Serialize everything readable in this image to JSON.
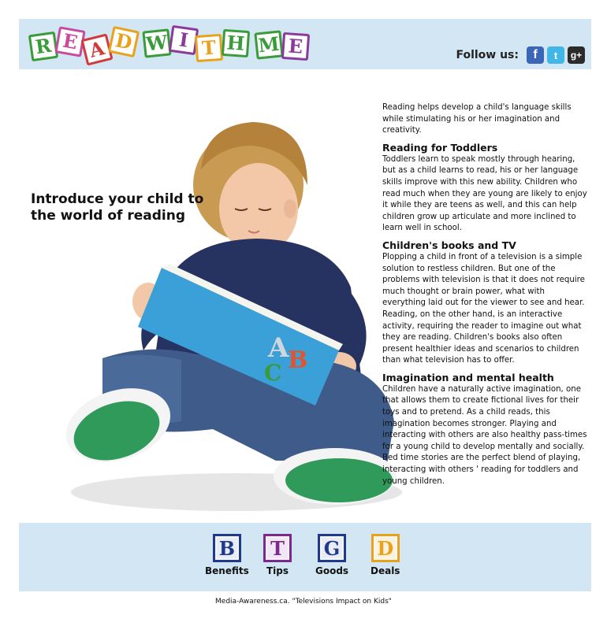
{
  "header": {
    "logo_letters": [
      {
        "char": "R",
        "color": "#3a9b3a"
      },
      {
        "char": "E",
        "color": "#c84aa0"
      },
      {
        "char": "A",
        "color": "#d23a3a"
      },
      {
        "char": "D",
        "color": "#e8a21c"
      },
      {
        "char": "W",
        "color": "#3a9b3a"
      },
      {
        "char": "I",
        "color": "#8b3a9b"
      },
      {
        "char": "T",
        "color": "#e8a21c"
      },
      {
        "char": "H",
        "color": "#3a9b3a"
      },
      {
        "char": "M",
        "color": "#3a9b3a"
      },
      {
        "char": "E",
        "color": "#8b3a9b"
      }
    ],
    "follow_label": "Follow us:",
    "social": {
      "facebook": "f",
      "twitter": "t",
      "googleplus": "g+"
    }
  },
  "hero": {
    "title": "Introduce your child to the world of reading"
  },
  "content": {
    "intro": "Reading helps develop a child's language skills while stimulating his or her imagination and creativity.",
    "sections": [
      {
        "heading": "Reading for Toddlers",
        "body": "Toddlers learn to speak mostly through hearing, but as a child learns to read, his or her language skills improve with this new ability. Children who read much when they are young are likely to enjoy it while they are teens as well, and this can help children grow up articulate and more inclined to learn well in school."
      },
      {
        "heading": "Children's books and TV",
        "body": "Plopping a child in front of a television is a simple solution to restless children. But one of the problems with television is that it does not require much thought or brain power, what with everything laid out for the viewer to see and hear. Reading, on the other hand, is an interactive activity, requiring the reader to imagine out what they are reading. Children's books also often present healthier ideas and scenarios to children than what television has to offer."
      },
      {
        "heading": "Imagination and mental health",
        "body": "Children have a naturally active imagination, one that allows them to create fictional lives for their toys and to pretend. As a child reads, this imagination becomes stronger. Playing and interacting with others are also healthy pass-times for a young child to develop mentally and socially. Bed time stories are the perfect blend of playing, interacting with others ' reading for toddlers and young children."
      }
    ]
  },
  "nav": {
    "items": [
      {
        "letter": "B",
        "label": "Benefits",
        "color": "#1f3a8a"
      },
      {
        "letter": "T",
        "label": "Tips",
        "color": "#7a2a8f"
      },
      {
        "letter": "G",
        "label": "Goods",
        "color": "#1f3a8a"
      },
      {
        "letter": "D",
        "label": "Deals",
        "color": "#e8a21c"
      }
    ]
  },
  "footer": {
    "credit": "Media-Awareness.ca. \"Televisions Impact on Kids\""
  }
}
